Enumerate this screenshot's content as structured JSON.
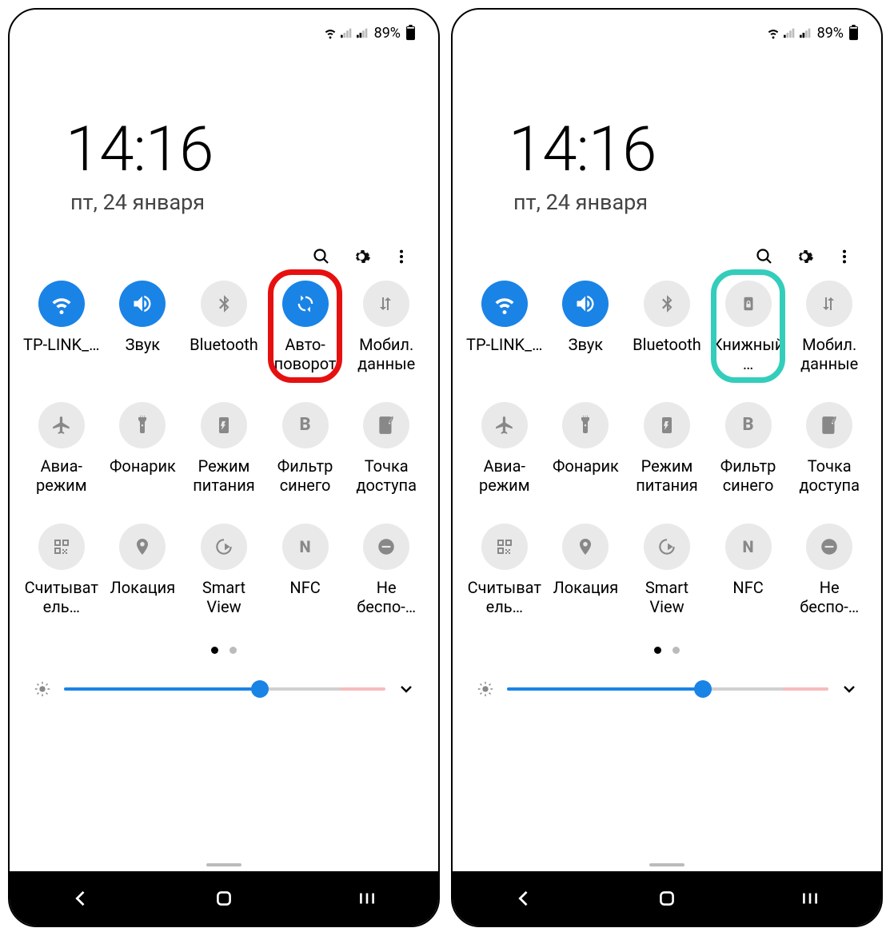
{
  "status": {
    "battery_pct": "89%"
  },
  "clock": "14:16",
  "date": "пт, 24 января",
  "brightness_pct": 61,
  "pager": {
    "pages": 2,
    "active": 0
  },
  "screens": [
    {
      "highlight_index": 3,
      "highlight_color": "red",
      "tiles": [
        {
          "label": "TP-LINK_…",
          "icon": "wifi",
          "on": true
        },
        {
          "label": "Звук",
          "icon": "sound",
          "on": true
        },
        {
          "label": "Bluetooth",
          "icon": "bluetooth",
          "on": false
        },
        {
          "label": "Авто-поворот",
          "icon": "autorotate",
          "on": true
        },
        {
          "label": "Мобил. данные",
          "icon": "data",
          "on": false
        },
        {
          "label": "Авиа-режим",
          "icon": "airplane",
          "on": false
        },
        {
          "label": "Фонарик",
          "icon": "flashlight",
          "on": false
        },
        {
          "label": "Режим питания",
          "icon": "powermode",
          "on": false
        },
        {
          "label": "Фильтр синего",
          "icon": "bluefilter",
          "on": false
        },
        {
          "label": "Точка доступа",
          "icon": "hotspot",
          "on": false
        },
        {
          "label": "Считыватель…",
          "icon": "qr",
          "on": false
        },
        {
          "label": "Локация",
          "icon": "location",
          "on": false
        },
        {
          "label": "Smart View",
          "icon": "smartview",
          "on": false
        },
        {
          "label": "NFC",
          "icon": "nfc",
          "on": false
        },
        {
          "label": "Не беспо-…",
          "icon": "dnd",
          "on": false
        }
      ]
    },
    {
      "highlight_index": 3,
      "highlight_color": "teal",
      "tiles": [
        {
          "label": "TP-LINK_…",
          "icon": "wifi",
          "on": true
        },
        {
          "label": "Звук",
          "icon": "sound",
          "on": true
        },
        {
          "label": "Bluetooth",
          "icon": "bluetooth",
          "on": false
        },
        {
          "label": "Книжный…",
          "icon": "portraitlock",
          "on": false
        },
        {
          "label": "Мобил. данные",
          "icon": "data",
          "on": false
        },
        {
          "label": "Авиа-режим",
          "icon": "airplane",
          "on": false
        },
        {
          "label": "Фонарик",
          "icon": "flashlight",
          "on": false
        },
        {
          "label": "Режим питания",
          "icon": "powermode",
          "on": false
        },
        {
          "label": "Фильтр синего",
          "icon": "bluefilter",
          "on": false
        },
        {
          "label": "Точка доступа",
          "icon": "hotspot",
          "on": false
        },
        {
          "label": "Считыватель…",
          "icon": "qr",
          "on": false
        },
        {
          "label": "Локация",
          "icon": "location",
          "on": false
        },
        {
          "label": "Smart View",
          "icon": "smartview",
          "on": false
        },
        {
          "label": "NFC",
          "icon": "nfc",
          "on": false
        },
        {
          "label": "Не беспо-…",
          "icon": "dnd",
          "on": false
        }
      ]
    }
  ]
}
